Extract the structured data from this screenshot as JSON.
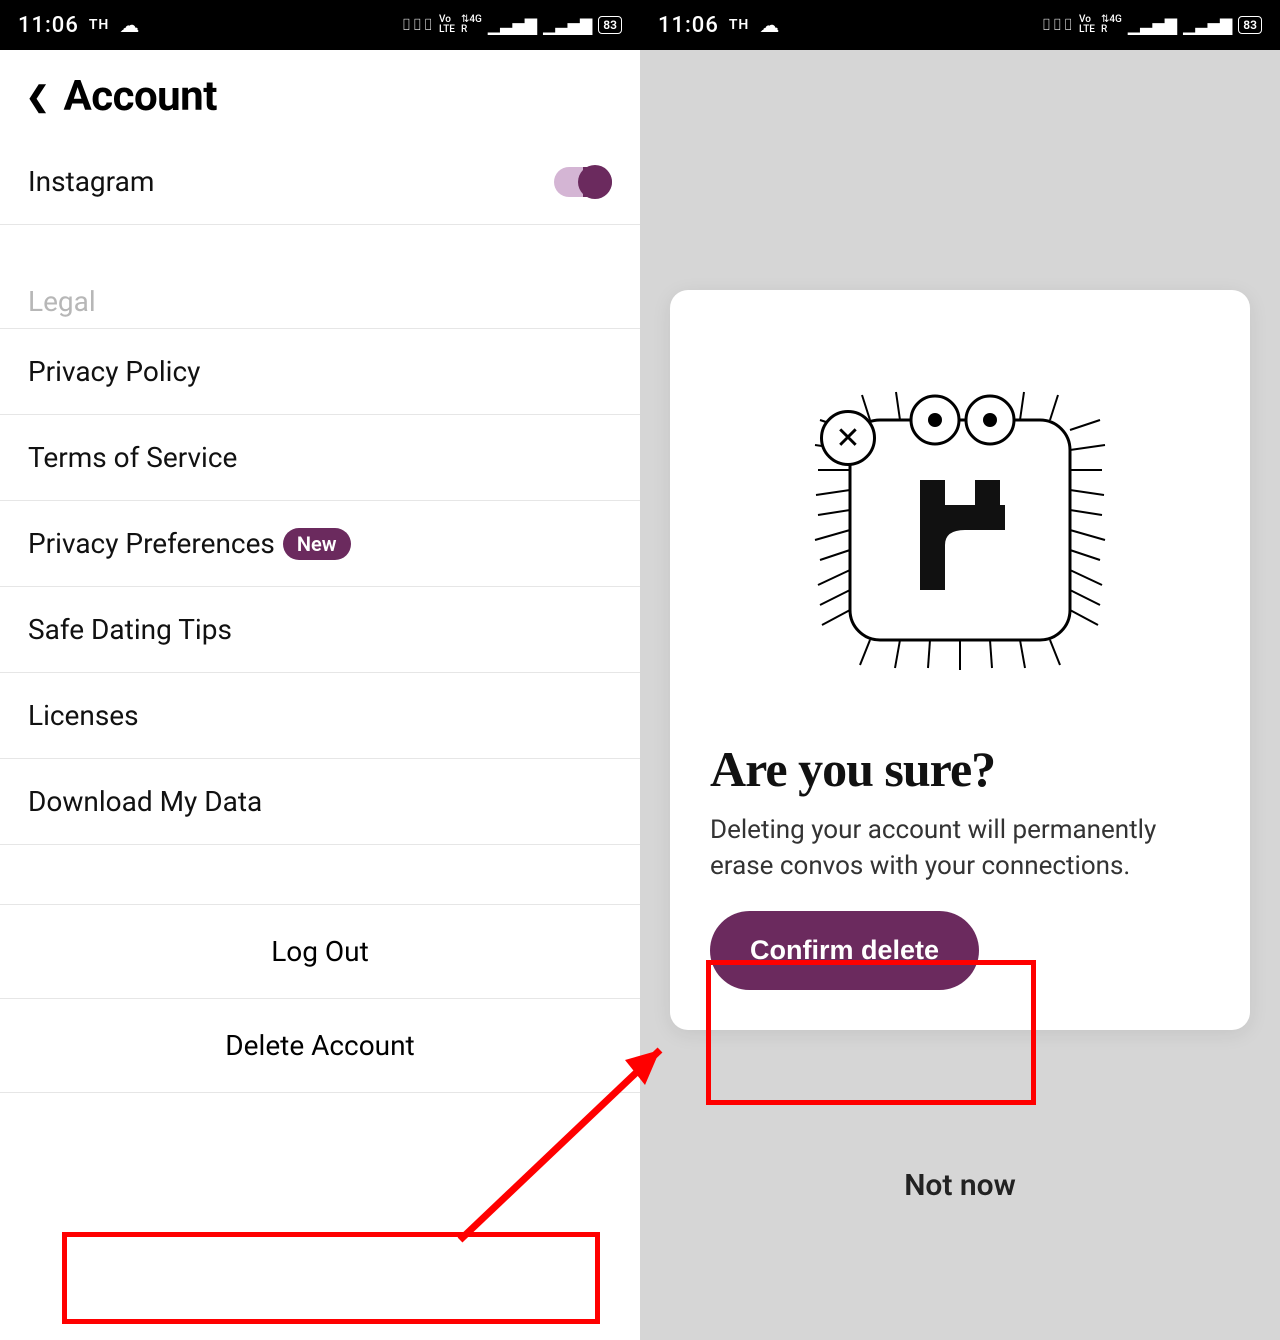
{
  "status": {
    "time": "11:06",
    "label": "TH",
    "battery": "83",
    "indicators": {
      "vibrate": "⬚",
      "volte": "Vo LTE",
      "net": "4G",
      "roam": "R"
    }
  },
  "left": {
    "header_title": "Account",
    "rows": {
      "instagram": "Instagram",
      "legal_section": "Legal",
      "privacy_policy": "Privacy Policy",
      "terms": "Terms of Service",
      "privacy_prefs": "Privacy Preferences",
      "new_badge": "New",
      "safe_dating": "Safe Dating Tips",
      "licenses": "Licenses",
      "download_data": "Download My Data",
      "log_out": "Log Out",
      "delete_account": "Delete Account"
    }
  },
  "right": {
    "modal": {
      "title": "Are you sure?",
      "description": "Deleting your account will permanently erase convos with your connections.",
      "confirm": "Confirm delete",
      "not_now": "Not now"
    }
  }
}
